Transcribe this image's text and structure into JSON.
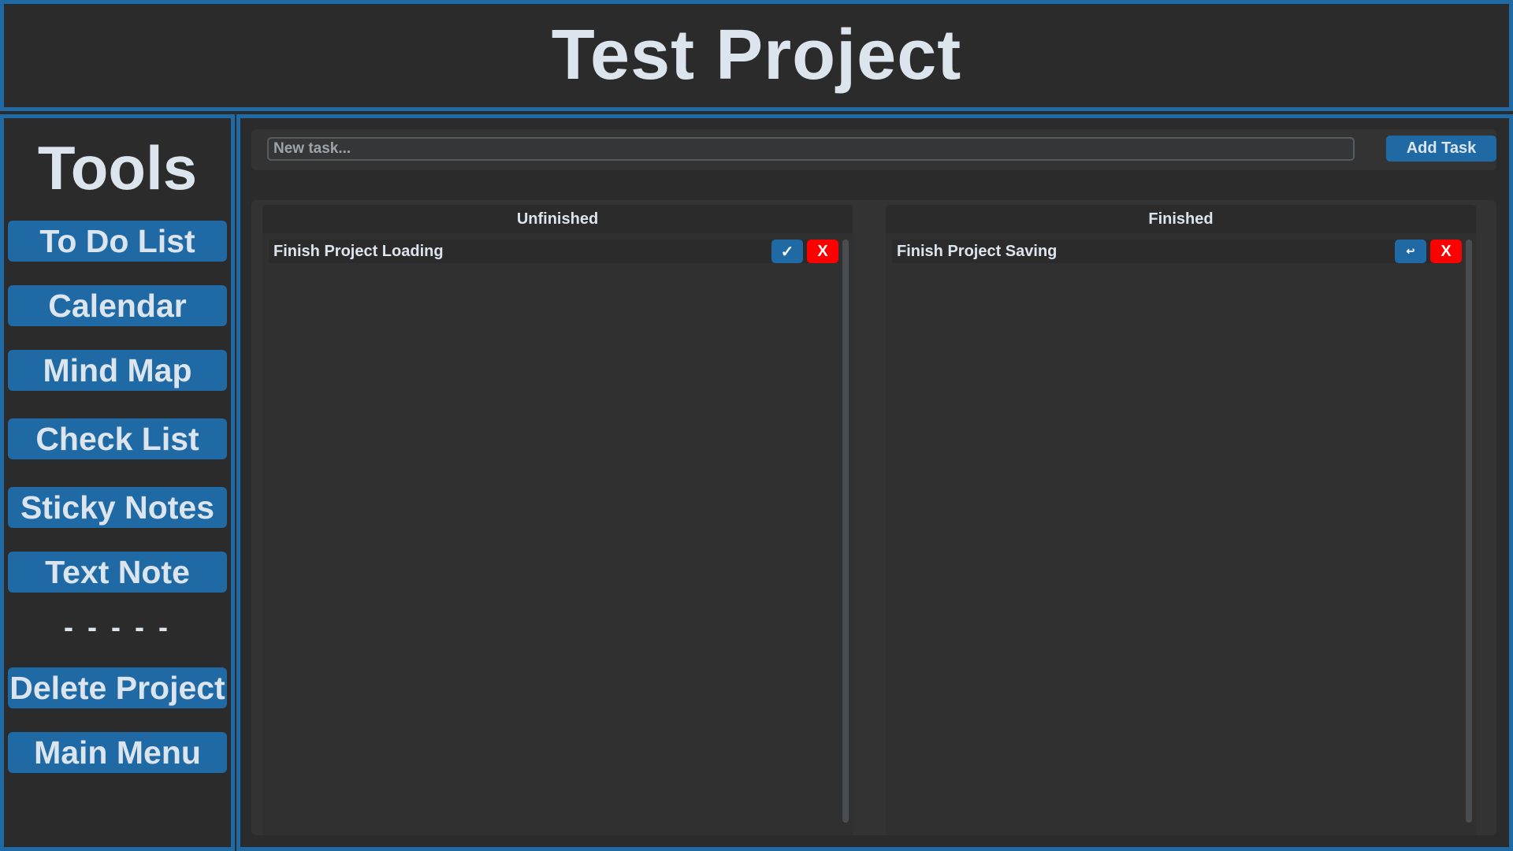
{
  "header": {
    "title": "Test Project"
  },
  "sidebar": {
    "title": "Tools",
    "buttons": [
      {
        "label": "To Do List"
      },
      {
        "label": "Calendar"
      },
      {
        "label": "Mind Map"
      },
      {
        "label": "Check List"
      },
      {
        "label": "Sticky Notes"
      },
      {
        "label": "Text Note"
      }
    ],
    "separator": "- - - - -",
    "bottom_buttons": [
      {
        "label": "Delete Project"
      },
      {
        "label": "Main Menu"
      }
    ]
  },
  "task_entry": {
    "placeholder": "New task...",
    "value": "",
    "add_label": "Add Task"
  },
  "columns": {
    "unfinished": {
      "header": "Unfinished",
      "tasks": [
        {
          "label": "Finish Project Loading",
          "action_icon": "check-icon",
          "action_glyph": "✓",
          "delete_glyph": "X"
        }
      ]
    },
    "finished": {
      "header": "Finished",
      "tasks": [
        {
          "label": "Finish Project Saving",
          "action_icon": "undo-icon",
          "action_glyph": "↩",
          "delete_glyph": "X"
        }
      ]
    }
  },
  "colors": {
    "accent": "#1f6aa5",
    "background": "#2b2b2b",
    "text": "#dce4ee",
    "danger": "#ff0000"
  }
}
